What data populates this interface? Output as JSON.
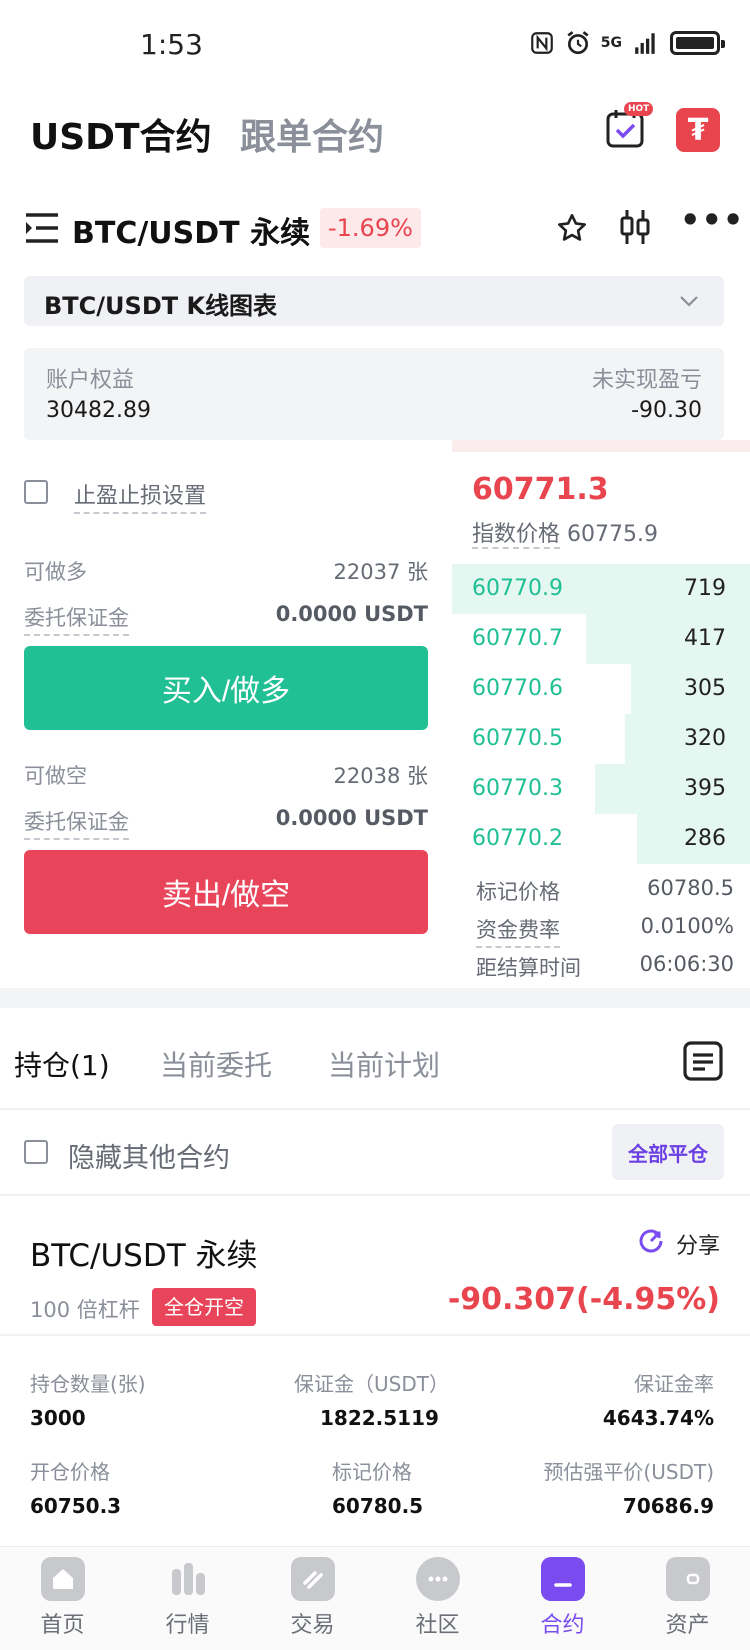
{
  "status_bar": {
    "time": "1:53",
    "network": "5G"
  },
  "header": {
    "tabs": [
      {
        "label": "USDT合约",
        "active": true
      },
      {
        "label": "跟单合约",
        "active": false
      }
    ],
    "badge": "HOT",
    "icons": [
      "calendar-check-icon",
      "tether-logo-icon"
    ]
  },
  "pair": {
    "name": "BTC/USDT  永续",
    "change": "-1.69%"
  },
  "kline": {
    "label": "BTC/USDT K线图表"
  },
  "account": {
    "equity_label": "账户权益",
    "equity_value": "30482.89",
    "unrealized_label": "未实现盈亏",
    "unrealized_value": "-90.30"
  },
  "trade": {
    "tpsl_label": "止盈止损设置",
    "long": {
      "avail_label": "可做多",
      "avail_value": "22037 张",
      "margin_label": "委托保证金",
      "margin_value": "0.0000 USDT",
      "button": "买入/做多"
    },
    "short": {
      "avail_label": "可做空",
      "avail_value": "22038 张",
      "margin_label": "委托保证金",
      "margin_value": "0.0000 USDT",
      "button": "卖出/做空"
    }
  },
  "orderbook": {
    "last_price": "60771.3",
    "index_label": "指数价格",
    "index_value": "60775.9",
    "bids": [
      {
        "price": "60770.9",
        "qty": "719",
        "depth": 1.0
      },
      {
        "price": "60770.7",
        "qty": "417",
        "depth": 0.55
      },
      {
        "price": "60770.6",
        "qty": "305",
        "depth": 0.4
      },
      {
        "price": "60770.5",
        "qty": "320",
        "depth": 0.42
      },
      {
        "price": "60770.3",
        "qty": "395",
        "depth": 0.52
      },
      {
        "price": "60770.2",
        "qty": "286",
        "depth": 0.38
      }
    ],
    "mark_label": "标记价格",
    "mark_value": "60780.5",
    "funding_label": "资金费率",
    "funding_value": "0.0100%",
    "settle_label": "距结算时间",
    "settle_value": "06:06:30"
  },
  "positions": {
    "tabs": [
      "持仓(1)",
      "当前委托",
      "当前计划"
    ],
    "hide_label": "隐藏其他合约",
    "close_all": "全部平仓",
    "item": {
      "name": "BTC/USDT 永续",
      "share": "分享",
      "leverage": "100 倍杠杆",
      "badge": "全仓开空",
      "pnl": "-90.307(-4.95%)",
      "qty_label": "持仓数量(张)",
      "qty_value": "3000",
      "margin_label": "保证金（USDT）",
      "margin_value": "1822.5119",
      "margin_rate_label": "保证金率",
      "margin_rate_value": "4643.74%",
      "open_label": "开仓价格",
      "open_value": "60750.3",
      "mark_label": "标记价格",
      "mark_value": "60780.5",
      "liq_label": "预估强平价(USDT)",
      "liq_value": "70686.9"
    }
  },
  "nav": [
    {
      "label": "首页",
      "icon": "home-icon"
    },
    {
      "label": "行情",
      "icon": "market-icon"
    },
    {
      "label": "交易",
      "icon": "trade-icon"
    },
    {
      "label": "社区",
      "icon": "community-icon"
    },
    {
      "label": "合约",
      "icon": "contract-icon",
      "active": true
    },
    {
      "label": "资产",
      "icon": "wallet-icon"
    }
  ],
  "colors": {
    "buy": "#20bf94",
    "sell": "#e8455a",
    "accent": "#7a4cf0"
  }
}
